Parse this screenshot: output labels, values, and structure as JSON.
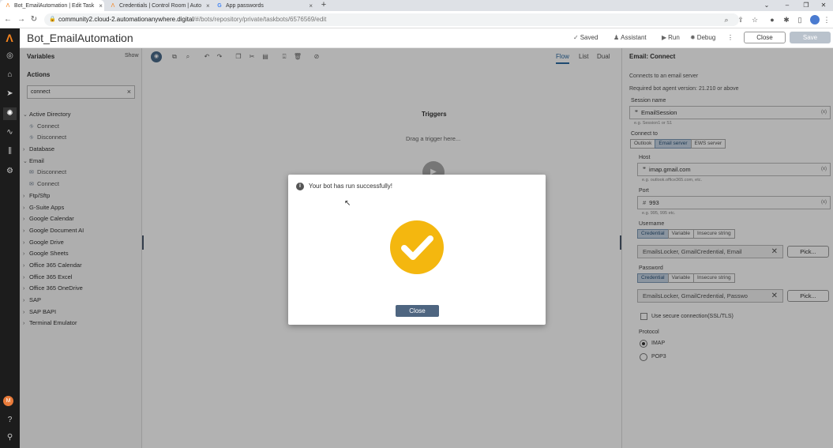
{
  "browser": {
    "tabs": [
      {
        "title": "Bot_EmailAutomation | Edit Task",
        "icon": "automation-anywhere-icon"
      },
      {
        "title": "Credentials | Control Room | Auto",
        "icon": "automation-anywhere-icon"
      },
      {
        "title": "App passwords",
        "icon": "google-icon"
      }
    ],
    "url_host": "community2.cloud-2.automationanywhere.digital",
    "url_path": "/#/bots/repository/private/taskbots/6576569/edit"
  },
  "app": {
    "title": "Bot_EmailAutomation",
    "header": {
      "saved": "Saved",
      "assistant": "Assistant",
      "run": "Run",
      "debug": "Debug",
      "close": "Close",
      "save": "Save"
    },
    "user_initial": "M"
  },
  "left_panel": {
    "variables_label": "Variables",
    "show_label": "Show",
    "actions_label": "Actions",
    "search_value": "connect",
    "tree": [
      {
        "label": "Active Directory",
        "expanded": true,
        "children": [
          "Connect",
          "Disconnect"
        ]
      },
      {
        "label": "Database",
        "expanded": false,
        "children": []
      },
      {
        "label": "Email",
        "expanded": true,
        "children": [
          "Disconnect",
          "Connect"
        ]
      },
      {
        "label": "Ftp/Sftp",
        "expanded": false,
        "children": []
      },
      {
        "label": "G-Suite Apps",
        "expanded": false,
        "children": []
      },
      {
        "label": "Google Calendar",
        "expanded": false,
        "children": []
      },
      {
        "label": "Google Document AI",
        "expanded": false,
        "children": []
      },
      {
        "label": "Google Drive",
        "expanded": false,
        "children": []
      },
      {
        "label": "Google Sheets",
        "expanded": false,
        "children": []
      },
      {
        "label": "Office 365 Calendar",
        "expanded": false,
        "children": []
      },
      {
        "label": "Office 365 Excel",
        "expanded": false,
        "children": []
      },
      {
        "label": "Office 365 OneDrive",
        "expanded": false,
        "children": []
      },
      {
        "label": "SAP",
        "expanded": false,
        "children": []
      },
      {
        "label": "SAP BAPI",
        "expanded": false,
        "children": []
      },
      {
        "label": "Terminal Emulator",
        "expanded": false,
        "children": []
      }
    ]
  },
  "canvas": {
    "view_tabs": [
      "Flow",
      "List",
      "Dual"
    ],
    "active_view": "Flow",
    "triggers_label": "Triggers",
    "drag_hint": "Drag a trigger here..."
  },
  "right_panel": {
    "title": "Email: Connect",
    "description": "Connects to an email server",
    "version_note": "Required bot agent version: 21.210 or above",
    "session_label": "Session name",
    "session_value": "EmailSession",
    "session_hint": "e.g. Session1 or S1",
    "connect_to_label": "Connect to",
    "connect_options": [
      "Outlook",
      "Email server",
      "EWS server"
    ],
    "connect_selected": "Email server",
    "host_label": "Host",
    "host_value": "imap.gmail.com",
    "host_hint": "e.g. outlook.office365.com, etc.",
    "port_label": "Port",
    "port_value": "993",
    "port_hint": "e.g. 995, 995 etc.",
    "username_label": "Username",
    "cred_options": [
      "Credential",
      "Variable",
      "Insecure string"
    ],
    "cred_selected": "Credential",
    "username_value": "EmailsLocker, GmailCredential, Email",
    "password_label": "Password",
    "password_value": "EmailsLocker, GmailCredential, Passwo",
    "pick_label": "Pick...",
    "ssl_label": "Use secure connection(SSL/TLS)",
    "protocol_label": "Protocol",
    "protocols": [
      "IMAP",
      "POP3"
    ],
    "protocol_selected": "IMAP",
    "var_button": "(x)"
  },
  "modal": {
    "message": "Your bot has run successfully!",
    "close_label": "Close",
    "check_color": "#f4b70f"
  }
}
